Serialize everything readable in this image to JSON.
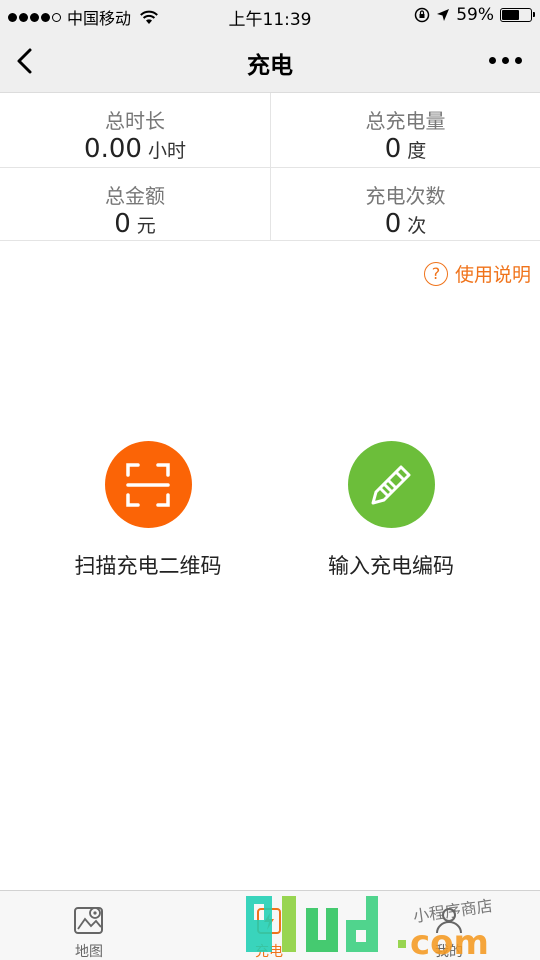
{
  "status_bar": {
    "carrier": "中国移动",
    "time": "上午11:39",
    "battery": "59%",
    "battery_level": 0.59
  },
  "nav": {
    "title": "充电"
  },
  "stats": {
    "total_duration": {
      "label": "总时长",
      "value": "0.00",
      "unit": "小时"
    },
    "total_energy": {
      "label": "总充电量",
      "value": "0",
      "unit": "度"
    },
    "total_amount": {
      "label": "总金额",
      "value": "0",
      "unit": "元"
    },
    "charge_count": {
      "label": "充电次数",
      "value": "0",
      "unit": "次"
    }
  },
  "help": {
    "icon": "question-circle-icon",
    "label": "使用说明"
  },
  "actions": {
    "scan": {
      "icon": "scan-icon",
      "label": "扫描充电二维码"
    },
    "input": {
      "icon": "pencil-icon",
      "label": "输入充电编码"
    }
  },
  "tabbar": {
    "map": {
      "icon": "map-icon",
      "label": "地图"
    },
    "charge": {
      "icon": "charge-icon",
      "label": "充电"
    },
    "me": {
      "icon": "user-icon",
      "label": "我的"
    }
  },
  "colors": {
    "accent": "#f0731a",
    "scan": "#fb6406",
    "input": "#6cbe3a"
  },
  "watermark": {
    "logo_text": "91ud.com",
    "tagline": "小程序商店"
  }
}
